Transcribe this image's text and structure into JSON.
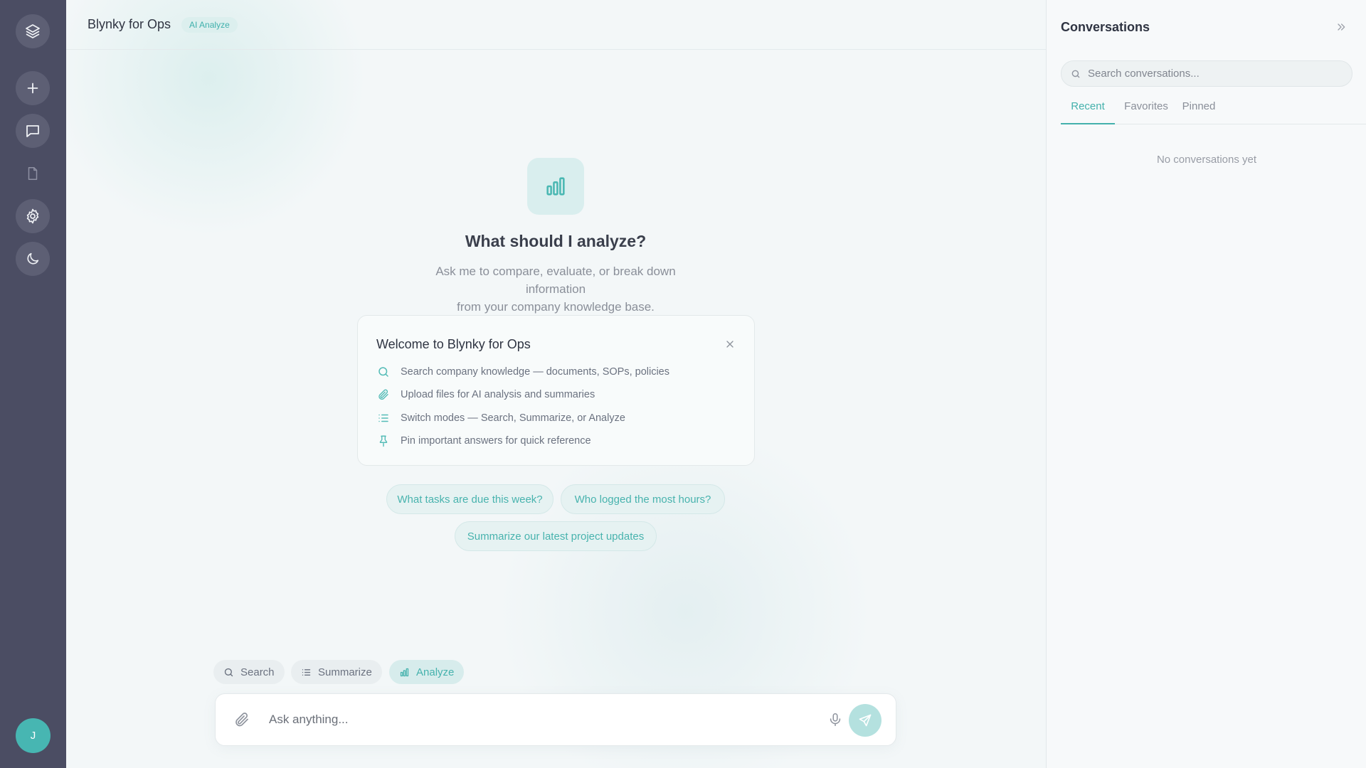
{
  "rail": {
    "items": [
      {
        "name": "layers-icon"
      },
      {
        "name": "plus-icon",
        "label": "New conversation"
      },
      {
        "name": "chat-icon"
      },
      {
        "name": "document-icon"
      },
      {
        "name": "gear-icon"
      },
      {
        "name": "moon-icon"
      }
    ],
    "avatar_initial": "J"
  },
  "header": {
    "app_title": "Blynky for Ops",
    "mode_badge": "AI Analyze"
  },
  "hero": {
    "icon": "bar-chart-icon",
    "title": "What should I analyze?",
    "subtitle_line1": "Ask me to compare, evaluate, or break down information",
    "subtitle_line2": "from your company knowledge base."
  },
  "welcome": {
    "title": "Welcome to Blynky for Ops",
    "features": [
      {
        "icon": "search-icon",
        "text": "Search company knowledge — documents, SOPs, policies"
      },
      {
        "icon": "paperclip-icon",
        "text": "Upload files for AI analysis and summaries"
      },
      {
        "icon": "list-icon",
        "text": "Switch modes — Search, Summarize, or Analyze"
      },
      {
        "icon": "pin-icon",
        "text": "Pin important answers for quick reference"
      }
    ]
  },
  "suggestions": [
    "What tasks are due this week?",
    "Who logged the most hours?",
    "Summarize our latest project updates"
  ],
  "modes": {
    "items": [
      "Search",
      "Summarize",
      "Analyze"
    ],
    "active": "Analyze"
  },
  "composer": {
    "placeholder": "Ask anything..."
  },
  "conversations": {
    "title": "Conversations",
    "search_placeholder": "Search conversations...",
    "tabs": [
      "Recent",
      "Favorites",
      "Pinned"
    ],
    "active_tab": "Recent",
    "empty_text": "No conversations yet"
  },
  "colors": {
    "accent": "#45b2ad",
    "rail_bg": "#4b4d63",
    "avatar": "#47b6b2"
  }
}
